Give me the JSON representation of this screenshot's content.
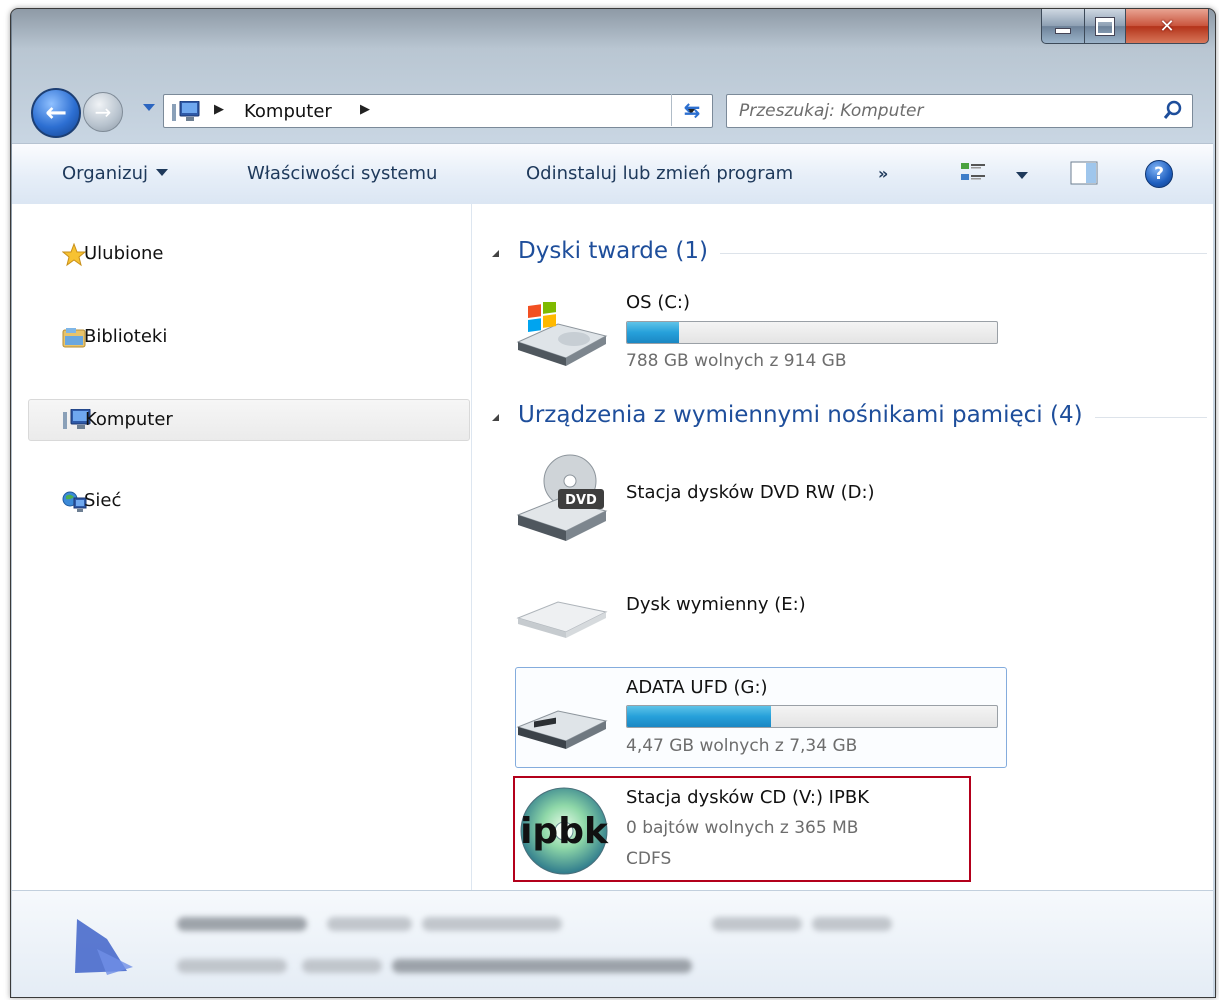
{
  "window": {
    "caption_buttons": [
      "minimize",
      "maximize",
      "close"
    ]
  },
  "nav": {
    "back_icon": "back-arrow-icon",
    "forward_icon": "forward-arrow-icon",
    "address_crumb": "Komputer",
    "search_placeholder": "Przeszukaj: Komputer"
  },
  "toolbar": {
    "organize": "Organizuj",
    "system_properties": "Właściwości systemu",
    "uninstall": "Odinstaluj lub zmień program",
    "more": "»"
  },
  "sidebar": {
    "items": [
      {
        "label": "Ulubione",
        "icon": "star-icon"
      },
      {
        "label": "Biblioteki",
        "icon": "libraries-icon"
      },
      {
        "label": "Komputer",
        "icon": "computer-icon"
      },
      {
        "label": "Sieć",
        "icon": "network-icon"
      }
    ]
  },
  "content": {
    "group_hdd": "Dyski twarde (1)",
    "group_removable": "Urządzenia z wymiennymi nośnikami pamięci (4)",
    "drives": [
      {
        "name": "OS (C:)",
        "free": "788 GB wolnych z 914 GB",
        "used_fraction": 0.14
      },
      {
        "name": "Stacja dysków DVD RW (D:)"
      },
      {
        "name": "Dysk wymienny (E:)"
      },
      {
        "name": "ADATA UFD (G:)",
        "free": "4,47 GB wolnych z 7,34 GB",
        "used_fraction": 0.39
      },
      {
        "name": "Stacja dysków CD (V:) IPBK",
        "free": "0 bajtów wolnych z 365 MB",
        "fs": "CDFS",
        "icon_text": "ipbk"
      }
    ]
  },
  "colors": {
    "group_header": "#1e4e9b",
    "bar_fill": "#26a0da",
    "highlight_border": "#b3001b"
  }
}
